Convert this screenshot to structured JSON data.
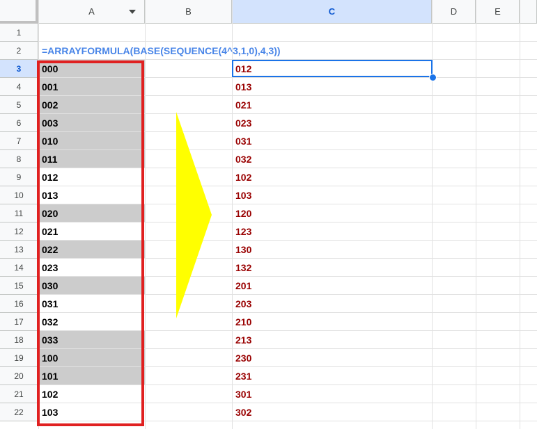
{
  "columns": [
    "A",
    "B",
    "C",
    "D",
    "E"
  ],
  "rows": [
    "1",
    "2",
    "3",
    "4",
    "5",
    "6",
    "7",
    "8",
    "9",
    "10",
    "11",
    "12",
    "13",
    "14",
    "15",
    "16",
    "17",
    "18",
    "19",
    "20",
    "21",
    "22"
  ],
  "selected_cell": {
    "column": "C",
    "row": "3"
  },
  "formula": "=ARRAYFORMULA(BASE(SEQUENCE(4^3,1,0),4,3))",
  "column_a": [
    {
      "value": "000",
      "highlight": true
    },
    {
      "value": "001",
      "highlight": true
    },
    {
      "value": "002",
      "highlight": true
    },
    {
      "value": "003",
      "highlight": true
    },
    {
      "value": "010",
      "highlight": true
    },
    {
      "value": "011",
      "highlight": true
    },
    {
      "value": "012",
      "highlight": false
    },
    {
      "value": "013",
      "highlight": false
    },
    {
      "value": "020",
      "highlight": true
    },
    {
      "value": "021",
      "highlight": false
    },
    {
      "value": "022",
      "highlight": true
    },
    {
      "value": "023",
      "highlight": false
    },
    {
      "value": "030",
      "highlight": true
    },
    {
      "value": "031",
      "highlight": false
    },
    {
      "value": "032",
      "highlight": false
    },
    {
      "value": "033",
      "highlight": true
    },
    {
      "value": "100",
      "highlight": true
    },
    {
      "value": "101",
      "highlight": true
    },
    {
      "value": "102",
      "highlight": false
    },
    {
      "value": "103",
      "highlight": false
    }
  ],
  "column_c": [
    "012",
    "013",
    "021",
    "023",
    "031",
    "032",
    "102",
    "103",
    "120",
    "123",
    "130",
    "132",
    "201",
    "203",
    "210",
    "213",
    "230",
    "231",
    "301",
    "302"
  ],
  "colors": {
    "formula_text": "#4a86e8",
    "result_text": "#990000",
    "highlight_fill": "#cccccc",
    "red_outline": "#e02020",
    "arrow_fill": "#ffff00",
    "selection": "#1a73e8"
  },
  "icons": {
    "column_a_filter": "dropdown-arrow-icon",
    "fill_handle": "fill-handle-icon"
  }
}
